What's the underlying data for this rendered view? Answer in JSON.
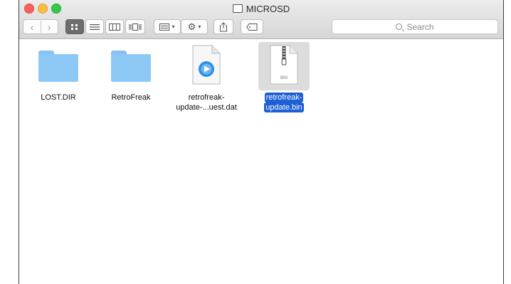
{
  "window": {
    "title": "MICROSD",
    "traffic_lights": {
      "close": "#fc605c",
      "minimize": "#fdbc40",
      "zoom": "#34c84a"
    }
  },
  "toolbar": {
    "back_icon": "chevron-left-icon",
    "forward_icon": "chevron-right-icon",
    "view_buttons": [
      {
        "name": "icon-view",
        "icon": "grid-icon",
        "active": true
      },
      {
        "name": "list-view",
        "icon": "list-icon",
        "active": false
      },
      {
        "name": "column-view",
        "icon": "columns-icon",
        "active": false
      },
      {
        "name": "coverflow-view",
        "icon": "coverflow-icon",
        "active": false
      }
    ],
    "arrange_icon": "arrange-icon",
    "action_icon": "gear-icon",
    "share_icon": "share-icon",
    "tags_icon": "tag-icon",
    "search_placeholder": "Search"
  },
  "files": [
    {
      "name": "LOST.DIR",
      "kind": "folder",
      "selected": false
    },
    {
      "name": "RetroFreak",
      "kind": "folder",
      "selected": false
    },
    {
      "name_line1": "retrofreak-",
      "name_line2": "update-...uest.dat",
      "kind": "quicktime-document",
      "selected": false
    },
    {
      "name_line1": "retrofreak-",
      "name_line2": "update.bin",
      "kind": "zip-archive",
      "icon_text": "BIN",
      "selected": true
    }
  ],
  "colors": {
    "folder_blue": "#8ec9f6",
    "selection_blue": "#1e5fd6",
    "quicktime_blue": "#2e8fe4"
  }
}
